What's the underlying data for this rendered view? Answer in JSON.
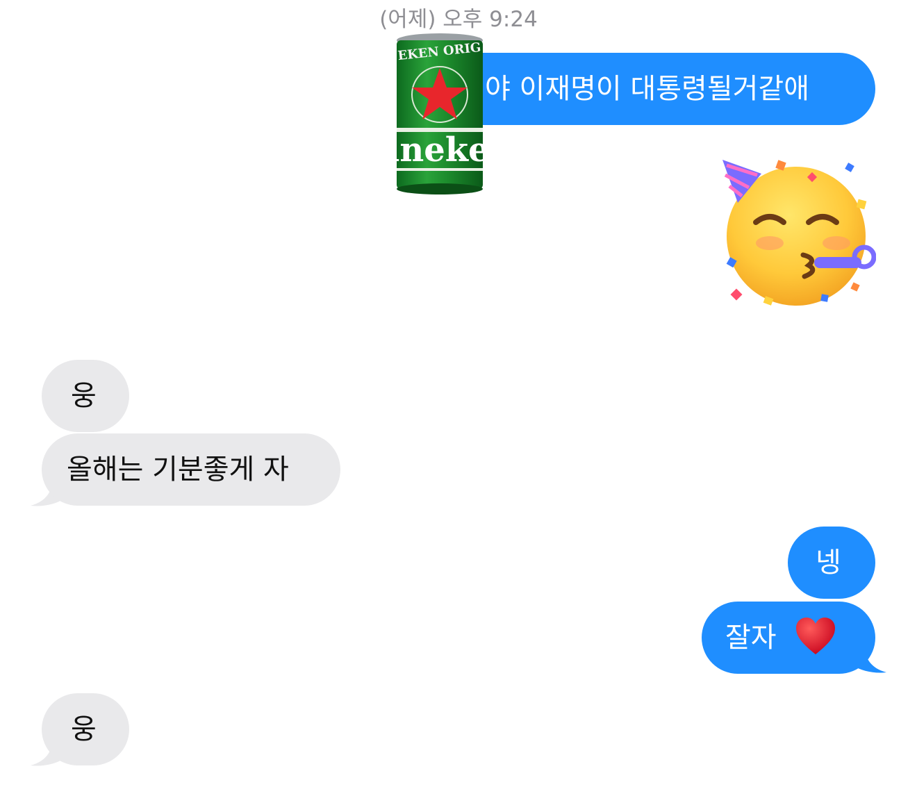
{
  "timestamp": "(어제) 오후 9:24",
  "colors": {
    "outgoing": "#1f8eff",
    "incoming": "#e9e9eb",
    "timestamp": "#8e8e93"
  },
  "messages": [
    {
      "sender": "me",
      "text": "야 이재명이 대통령될거같애"
    },
    {
      "sender": "me",
      "sticker": "heineken-can",
      "sticker_text": "eineken"
    },
    {
      "sender": "me",
      "sticker": "partying-face-emoji"
    },
    {
      "sender": "them",
      "text": "웅"
    },
    {
      "sender": "them",
      "text": "올해는 기분좋게 자"
    },
    {
      "sender": "me",
      "text": "넹"
    },
    {
      "sender": "me",
      "text": "잘자",
      "emoji": "red-heart-emoji"
    },
    {
      "sender": "them",
      "text": "웅"
    }
  ]
}
